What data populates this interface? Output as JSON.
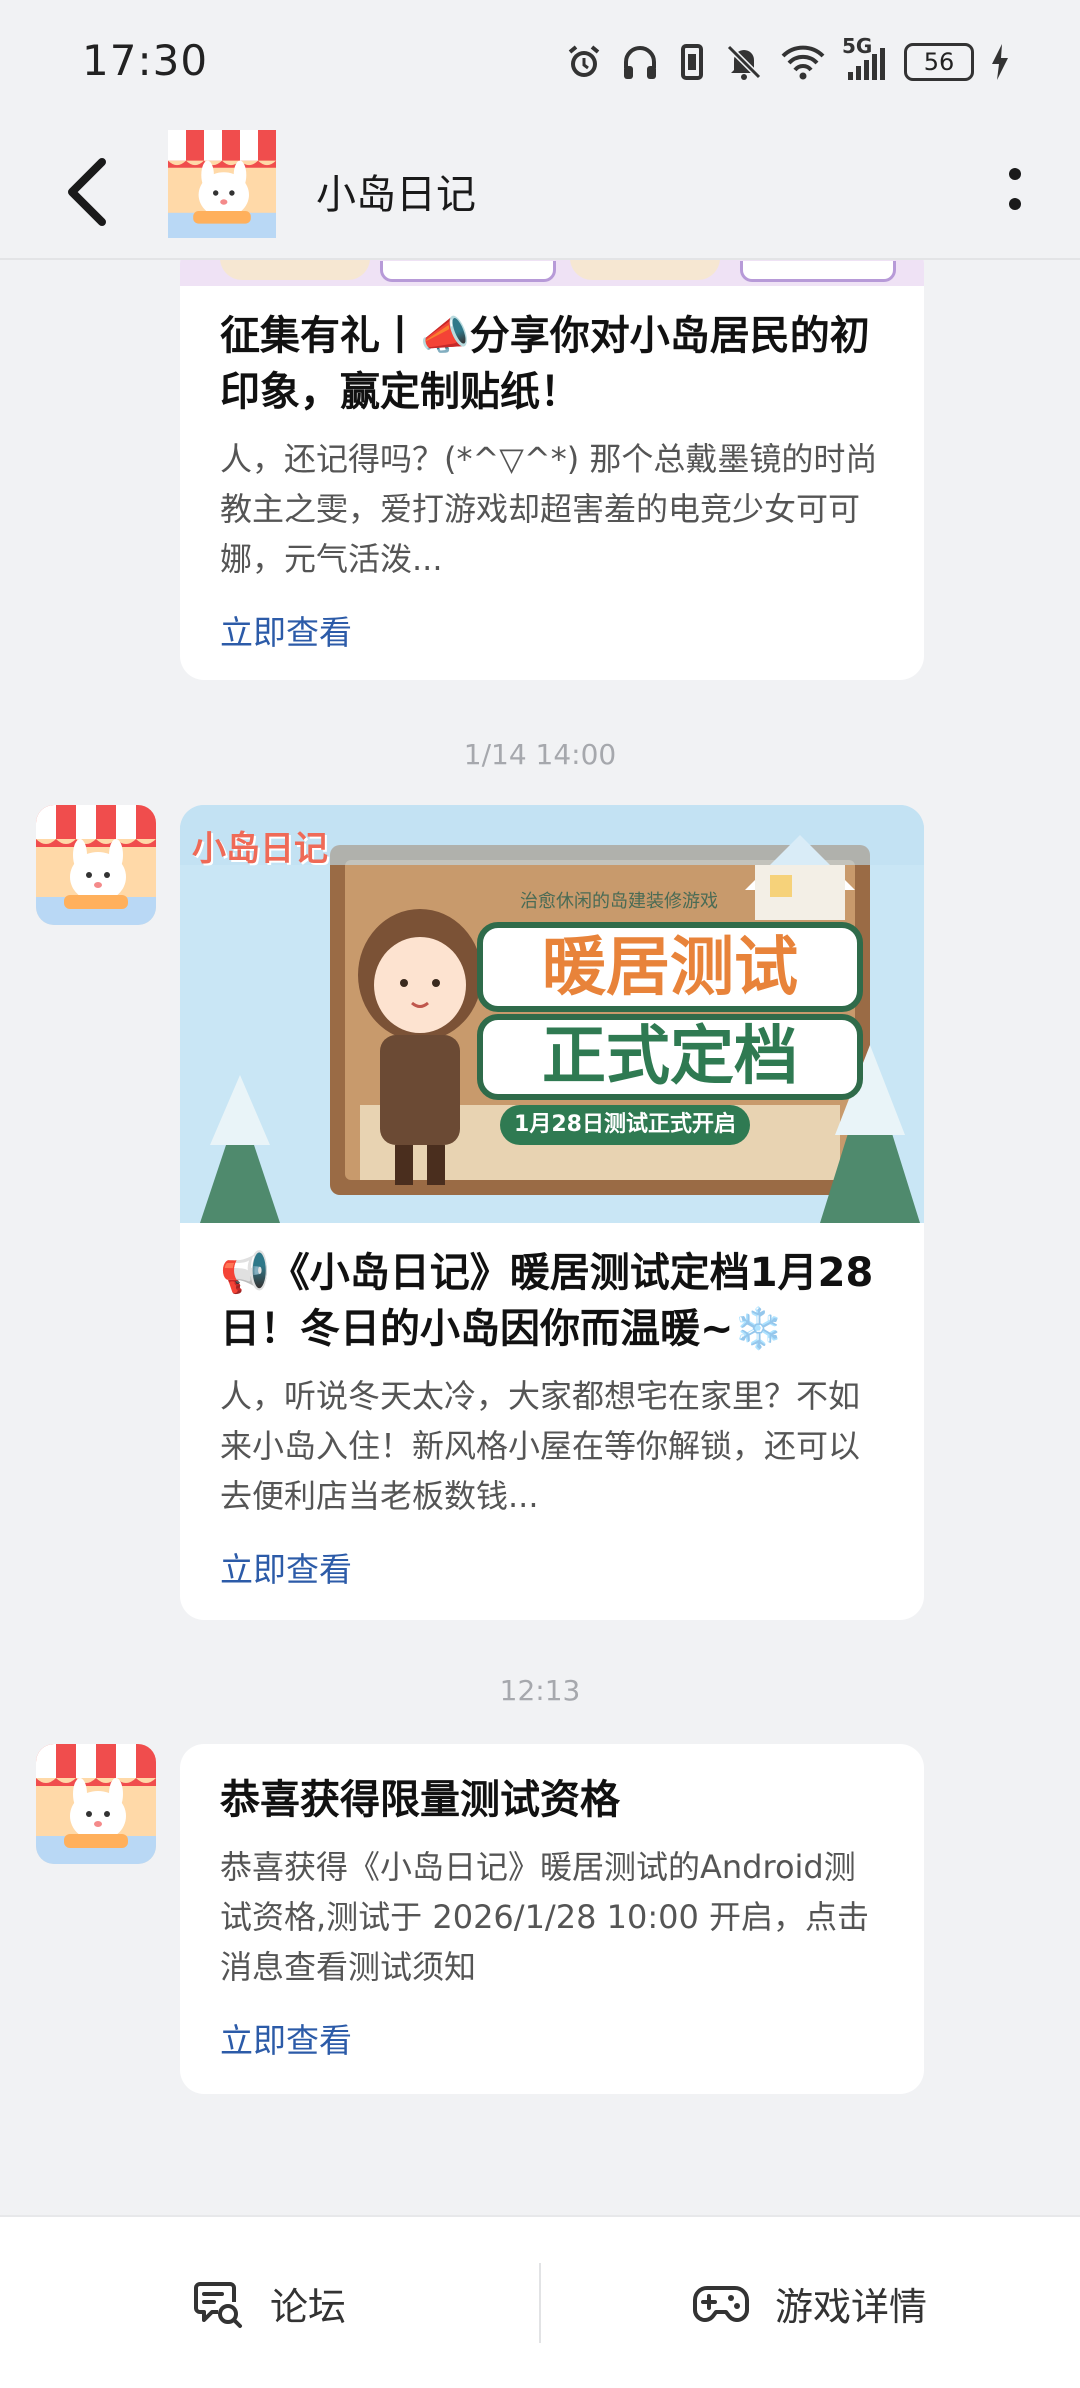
{
  "status_bar": {
    "time": "17:30",
    "network": "5G",
    "battery": "56",
    "icons": [
      "alarm-icon",
      "headphones-icon",
      "vibrate-icon",
      "mute-icon",
      "wifi-icon",
      "signal-icon",
      "battery-icon",
      "charging-icon"
    ]
  },
  "header": {
    "title": "小岛日记",
    "back_icon": "chevron-left-icon",
    "more_icon": "more-vertical-icon"
  },
  "messages": [
    {
      "title": "征集有礼丨📣分享你对小岛居民的初印象，赢定制贴纸！",
      "desc": "人，还记得吗？(*^▽^*) 那个总戴墨镜的时尚教主之雯，爱打游戏却超害羞的电竞少女可可娜，元气活泼...",
      "link": "立即查看"
    },
    {
      "timestamp": "1/14  14:00",
      "banner": {
        "logo": "小岛日记",
        "subtitle": "治愈休闲的岛建装修游戏",
        "headline_1": "暖居测试",
        "headline_2": "正式定档",
        "date_ribbon": "1月28日测试正式开启"
      },
      "title": "📢《小岛日记》暖居测试定档1月28日！冬日的小岛因你而温暖~❄️",
      "desc": "人，听说冬天太冷，大家都想宅在家里？不如来小岛入住！新风格小屋在等你解锁，还可以去便利店当老板数钱...",
      "link": "立即查看"
    },
    {
      "timestamp": "12:13",
      "title": "恭喜获得限量测试资格",
      "desc": "恭喜获得《小岛日记》暖居测试的Android测试资格,测试于 2026/1/28 10:00 开启，点击消息查看测试须知",
      "link": "立即查看"
    }
  ],
  "bottom_nav": {
    "forum_label": "论坛",
    "forum_icon": "chat-search-icon",
    "details_label": "游戏详情",
    "details_icon": "gamepad-icon"
  }
}
